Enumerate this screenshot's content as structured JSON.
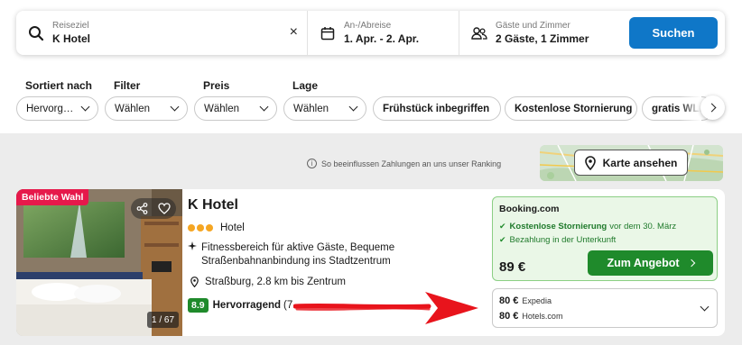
{
  "search": {
    "destination_label": "Reiseziel",
    "destination_value": "K Hotel",
    "clear_icon": "×",
    "dates_label": "An-/Abreise",
    "dates_value": "1. Apr. - 2. Apr.",
    "guests_label": "Gäste und Zimmer",
    "guests_value": "2 Gäste, 1 Zimmer",
    "search_button": "Suchen"
  },
  "filters": {
    "sort": {
      "label": "Sortiert nach",
      "value": "Hervorg…"
    },
    "filter": {
      "label": "Filter",
      "value": "Wählen"
    },
    "price": {
      "label": "Preis",
      "value": "Wählen"
    },
    "location": {
      "label": "Lage",
      "value": "Wählen"
    },
    "chips": [
      "Frühstück inbegriffen",
      "Kostenlose Stornierung",
      "gratis WLAN"
    ]
  },
  "ranking_note": "So beeinflussen Zahlungen an uns unser Ranking",
  "map_button": "Karte ansehen",
  "result": {
    "badge": "Beliebte Wahl",
    "photo_counter": "1 / 67",
    "name": "K Hotel",
    "type": "Hotel",
    "stars": 3,
    "features": "Fitnessbereich für aktive Gäste, Bequeme Straßenbahnanbindung ins Stadtzentrum",
    "location": "Straßburg, 2.8 km bis Zentrum",
    "rating_score": "8.9",
    "rating_label": "Hervorragend",
    "rating_count": "(7",
    "offer": {
      "provider": "Booking.com",
      "perk1_bold": "Kostenlose Stornierung",
      "perk1_rest": "vor dem 30. März",
      "perk2": "Bezahlung in der Unterkunft",
      "price": "89 €",
      "button": "Zum Angebot"
    },
    "other_offers": [
      {
        "price": "80 €",
        "provider": "Expedia"
      },
      {
        "price": "80 €",
        "provider": "Hotels.com"
      }
    ]
  },
  "colors": {
    "brand_blue": "#0f77c8",
    "deal_green": "#1f8a2b",
    "badge_pink": "#e6194b",
    "annotation_red": "#e8141c"
  }
}
